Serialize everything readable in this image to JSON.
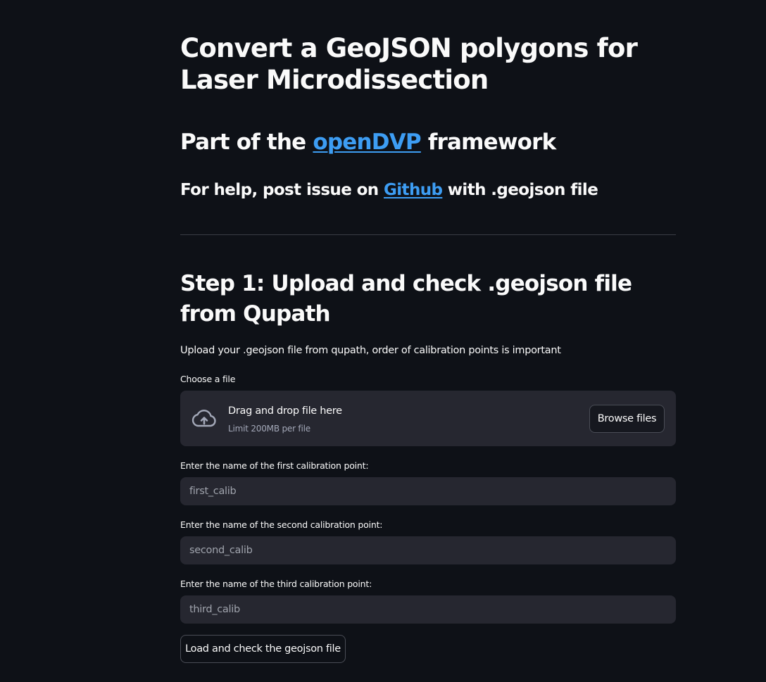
{
  "page": {
    "title": "Convert a GeoJSON polygons for Laser Microdissection",
    "subtitle": {
      "prefix": "Part of the ",
      "link_text": "openDVP",
      "suffix": " framework"
    },
    "help": {
      "prefix": "For help, post issue on ",
      "link_text": "Github",
      "suffix": " with .geojson file"
    }
  },
  "step1": {
    "heading": "Step 1: Upload and check .geojson file from Qupath",
    "description": "Upload your .geojson file from qupath, order of calibration points is important",
    "uploader": {
      "label": "Choose a file",
      "drop_text": "Drag and drop file here",
      "limit_text": "Limit 200MB per file",
      "browse_label": "Browse files"
    },
    "calib1": {
      "label": "Enter the name of the first calibration point:",
      "placeholder": "first_calib"
    },
    "calib2": {
      "label": "Enter the name of the second calibration point:",
      "placeholder": "second_calib"
    },
    "calib3": {
      "label": "Enter the name of the third calibration point:",
      "placeholder": "third_calib"
    },
    "load_button": "Load and check the geojson file"
  },
  "colors": {
    "background": "#0e1117",
    "link": "#3d9df3",
    "input_bg": "#262730",
    "text": "#fafafa"
  },
  "icons": {
    "upload": "cloud-upload-icon"
  }
}
